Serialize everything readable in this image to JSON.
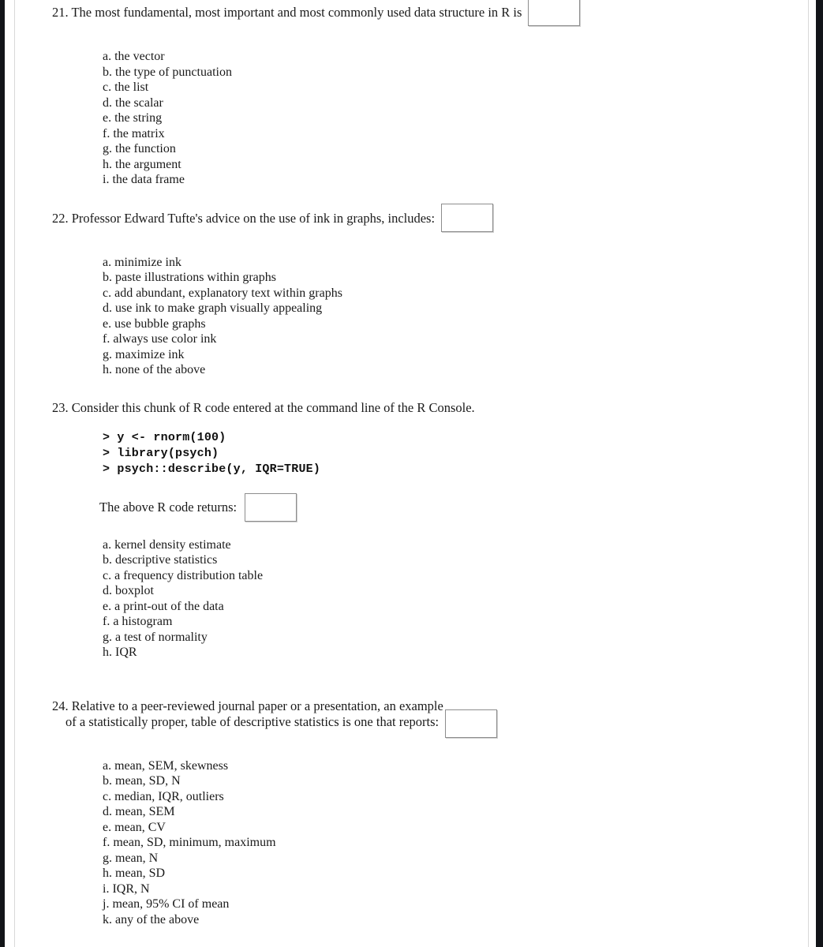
{
  "document": {
    "type": "exam-page",
    "questions": [
      {
        "number": "21.",
        "prompt": "21. The most fundamental, most important and most commonly used data structure in R is",
        "answer_box_value": "",
        "options": [
          "a. the vector",
          "b. the type of punctuation",
          "c. the list",
          "d. the scalar",
          "e. the string",
          "f. the matrix",
          "g. the function",
          "h. the argument",
          "i. the data frame"
        ]
      },
      {
        "number": "22.",
        "prompt": "22. Professor Edward Tufte's advice on the use of ink in graphs, includes:",
        "answer_box_value": "",
        "options": [
          "a. minimize ink",
          "b. paste illustrations within graphs",
          "c. add abundant, explanatory text within graphs",
          "d. use ink to make graph visually appealing",
          "e. use bubble graphs",
          "f. always use color ink",
          "g. maximize ink",
          "h. none of the above"
        ]
      },
      {
        "number": "23.",
        "prompt": "23. Consider this chunk of R code entered at the command line of the R Console.",
        "code_lines": [
          "> y <- rnorm(100)",
          "> library(psych)",
          "> psych::describe(y, IQR=TRUE)"
        ],
        "returns_label": "The above R code returns:",
        "answer_box_value": "",
        "options": [
          "a. kernel density estimate",
          "b. descriptive statistics",
          "c. a frequency distribution table",
          "d. boxplot",
          "e. a print-out of the data",
          "f. a histogram",
          "g. a test of normality",
          "h. IQR"
        ]
      },
      {
        "number": "24.",
        "prompt_line_1": "24. Relative to a peer-reviewed journal paper or a presentation, an example",
        "prompt_line_2": "of a statistically proper, table of descriptive statistics is one that reports:",
        "answer_box_value": "",
        "options": [
          "a. mean, SEM, skewness",
          "b. mean, SD, N",
          "c. median, IQR, outliers",
          "d. mean, SEM",
          "e. mean, CV",
          "f. mean, SD, minimum, maximum",
          "g. mean, N",
          "h. mean, SD",
          "i. IQR, N",
          "j. mean, 95% CI of mean",
          "k. any of the above"
        ]
      }
    ]
  },
  "colors": {
    "page_background": "#ffffff",
    "text": "#1a1a1a",
    "answer_box_border": "#8d8d8d",
    "scan_edge": "#121418"
  }
}
